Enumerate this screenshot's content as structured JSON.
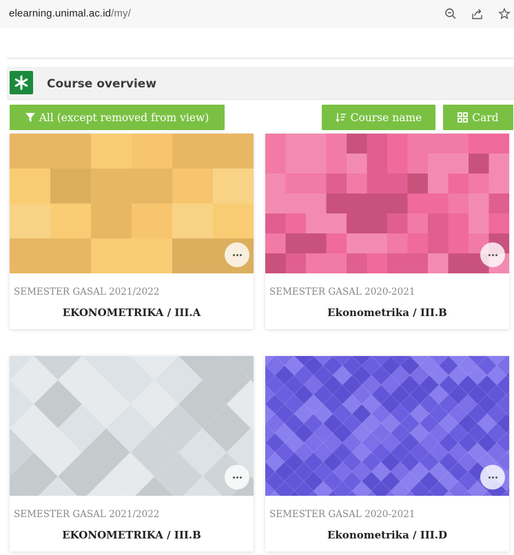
{
  "browser": {
    "url_host": "elearning.unimal.ac.id",
    "url_path": "/my/",
    "icons": [
      "zoom-out-icon",
      "share-icon",
      "bookmark-star-icon"
    ]
  },
  "block": {
    "title": "Course overview",
    "icon": "asterisk-icon",
    "accent": "#1b8a3d"
  },
  "controls": {
    "filter_label": "All (except removed from view)",
    "sort_label": "Course name",
    "view_label": "Card",
    "button_color": "#7ac143"
  },
  "courses": [
    {
      "category": "SEMESTER GASAL 2021/2022",
      "name": "EKONOMETRIKA / III.A",
      "pattern": "squares",
      "palette": [
        "#f9cc74",
        "#f6c56e",
        "#e8b763",
        "#f8d385",
        "#dcaf5e"
      ]
    },
    {
      "category": "SEMESTER GASAL 2020-2021",
      "name": "Ekonometrika / III.B",
      "pattern": "squares",
      "palette": [
        "#f27aa6",
        "#e05f90",
        "#f38bb1",
        "#c9527d",
        "#f06a9c"
      ]
    },
    {
      "category": "SEMESTER GASAL 2021/2022",
      "name": "EKONOMETRIKA / III.B",
      "pattern": "diamonds",
      "palette": [
        "#dde2e6",
        "#cfd4d8",
        "#e6eaed",
        "#c5cacd"
      ]
    },
    {
      "category": "SEMESTER GASAL 2020-2021",
      "name": "Ekonometrika / III.D",
      "pattern": "diamonds",
      "palette": [
        "#6b5fe0",
        "#7c6fe8",
        "#5c50d2",
        "#8a7fee",
        "#6256d8"
      ]
    }
  ]
}
